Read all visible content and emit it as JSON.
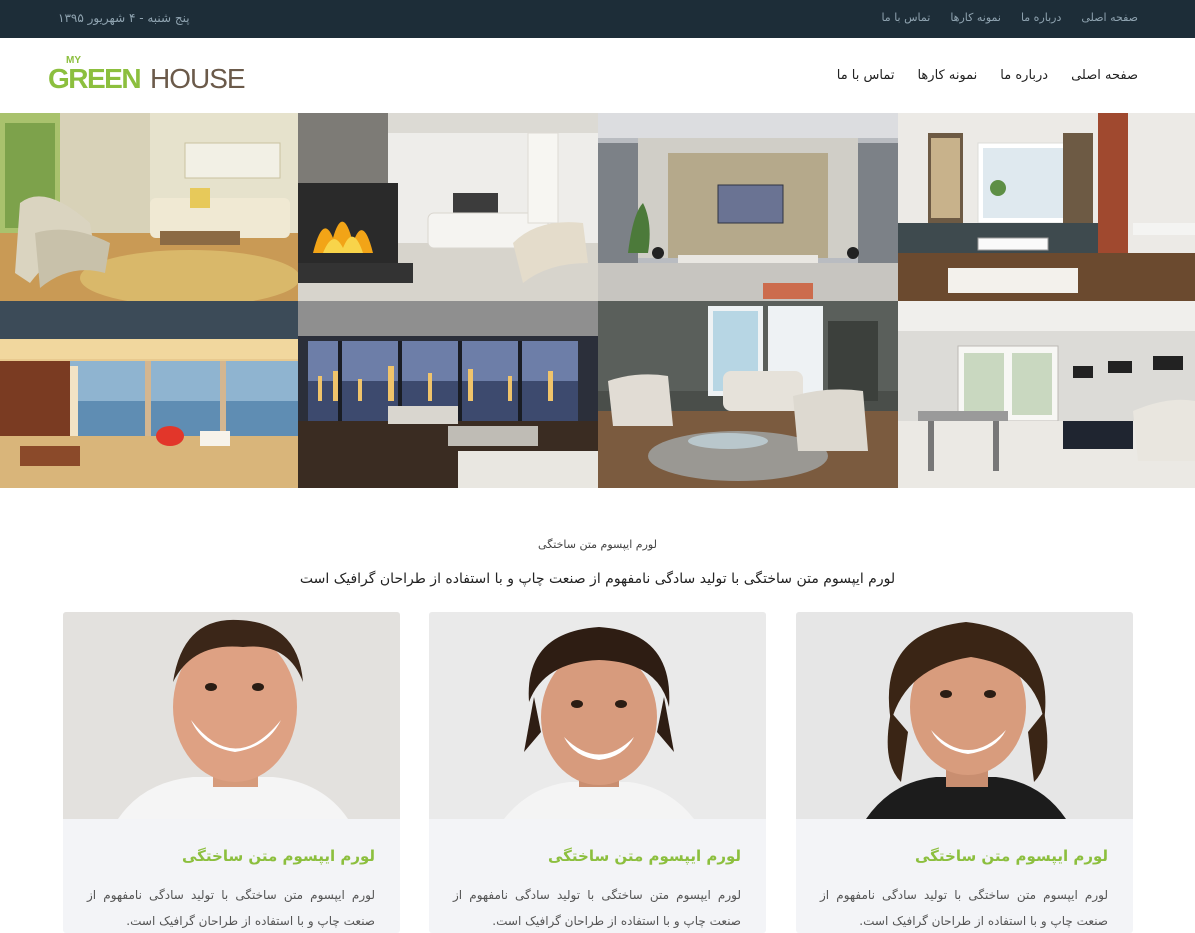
{
  "topbar": {
    "date": "پنج شنبه - ۴ شهریور ۱۳۹۵",
    "links": [
      "صفحه اصلی",
      "درباره ما",
      "نمونه کارها",
      "تماس با ما"
    ]
  },
  "logo": {
    "my": "MY",
    "green": "GREEN",
    "house": "HOUSE"
  },
  "nav": {
    "items": [
      "صفحه اصلی",
      "درباره ما",
      "نمونه کارها",
      "تماس با ما"
    ]
  },
  "intro": {
    "small": "لورم ایپسوم متن ساختگی",
    "big": "لورم ایپسوم متن ساختگی با تولید سادگی نامفهوم از صنعت چاپ و با استفاده از طراحان گرافیک است"
  },
  "cards": [
    {
      "title": "لورم ایپسوم متن ساختگی",
      "text": "لورم ایپسوم متن ساختگی با تولید سادگی نامفهوم از صنعت چاپ و با استفاده از طراحان گرافیک است."
    },
    {
      "title": "لورم ایپسوم متن ساختگی",
      "text": "لورم ایپسوم متن ساختگی با تولید سادگی نامفهوم از صنعت چاپ و با استفاده از طراحان گرافیک است."
    },
    {
      "title": "لورم ایپسوم متن ساختگی",
      "text": "لورم ایپسوم متن ساختگی با تولید سادگی نامفهوم از صنعت چاپ و با استفاده از طراحان گرافیک است."
    }
  ],
  "colors": {
    "topbar": "#1d2d38",
    "accent": "#8cbf3e",
    "logo_house": "#6b5a4a",
    "card_bg": "#f3f4f7"
  }
}
